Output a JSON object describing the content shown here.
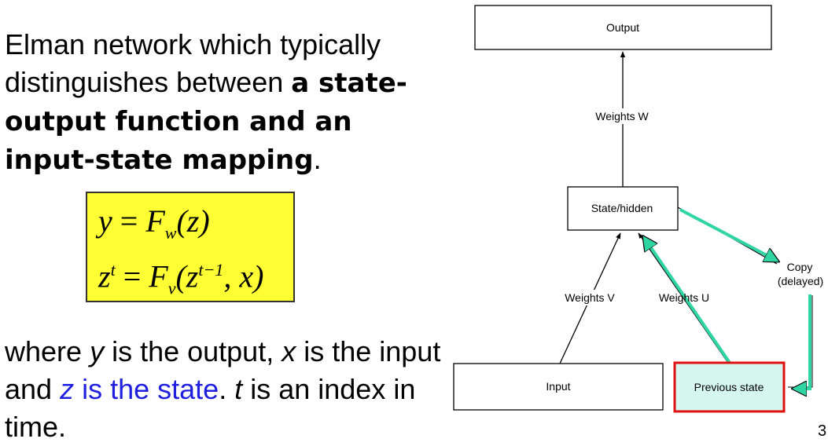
{
  "text": {
    "p1_part1": "Elman network which typically distinguishes between ",
    "p1_bold": "a state-output function and an input-state mapping",
    "p1_end": ".",
    "p2_where": "where ",
    "p2_y": "y",
    "p2_is_output": " is the output, ",
    "p2_x": "x",
    "p2_is_input": " is the input and ",
    "p2_z": "z",
    "p2_is_state": " is the state",
    "p2_dot": ". ",
    "p2_t": "t",
    "p2_index": " is an index in time."
  },
  "formula": {
    "line1": {
      "lhs": "y",
      "eq": " = ",
      "F": "F",
      "sub": "w",
      "arg": "(z)"
    },
    "line2": {
      "lhs": "z",
      "sup_t": "t",
      "eq": " = ",
      "F": "F",
      "sub": "v",
      "open": "(z",
      "sup_tm1": "t−1",
      "close": ", x)"
    }
  },
  "diagram": {
    "output": "Output",
    "weights_w": "Weights W",
    "state_hidden": "State/hidden",
    "weights_v": "Weights V",
    "weights_u": "Weights U",
    "copy_line1": "Copy",
    "copy_line2": "(delayed)",
    "input": "Input",
    "previous_state": "Previous state"
  },
  "colors": {
    "formula_bg": "#ffff33",
    "arrow_green": "#2fd6a4",
    "prev_state_fill": "#d5f7ee",
    "prev_state_border": "#e01010",
    "state_text": "#1f1fe0"
  },
  "page_number": "3"
}
